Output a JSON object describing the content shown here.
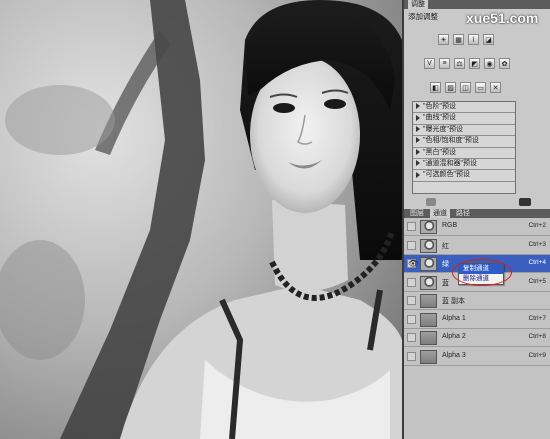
{
  "brand": {
    "watermark": "xue51.com"
  },
  "adjustments_panel": {
    "tab_label": "调整",
    "subtitle": "添加调整",
    "presets": [
      "\"色阶\"预设",
      "\"曲线\"预设",
      "\"曝光度\"预设",
      "\"色相/饱和度\"预设",
      "\"黑白\"预设",
      "\"通道混和器\"预设",
      "\"可选颜色\"预设"
    ]
  },
  "channels_panel": {
    "tabs": [
      "图层",
      "通道",
      "路径"
    ],
    "active_tab": "通道",
    "channels": [
      {
        "name": "RGB",
        "shortcut": "Ctrl+2",
        "visible": false,
        "selected": false
      },
      {
        "name": "红",
        "shortcut": "Ctrl+3",
        "visible": false,
        "selected": false
      },
      {
        "name": "绿",
        "shortcut": "Ctrl+4",
        "visible": true,
        "selected": true
      },
      {
        "name": "蓝",
        "shortcut": "Ctrl+5",
        "visible": false,
        "selected": false
      },
      {
        "name": "蓝 副本",
        "shortcut": "",
        "visible": false,
        "selected": false
      },
      {
        "name": "Alpha 1",
        "shortcut": "Ctrl+7",
        "visible": false,
        "selected": false
      },
      {
        "name": "Alpha 2",
        "shortcut": "Ctrl+8",
        "visible": false,
        "selected": false
      },
      {
        "name": "Alpha 3",
        "shortcut": "Ctrl+9",
        "visible": false,
        "selected": false
      }
    ],
    "context_menu": [
      "复制通道",
      "删除通道"
    ]
  },
  "colors": {
    "selection": "#3a5fbf",
    "highlight_circle": "#d42020"
  }
}
